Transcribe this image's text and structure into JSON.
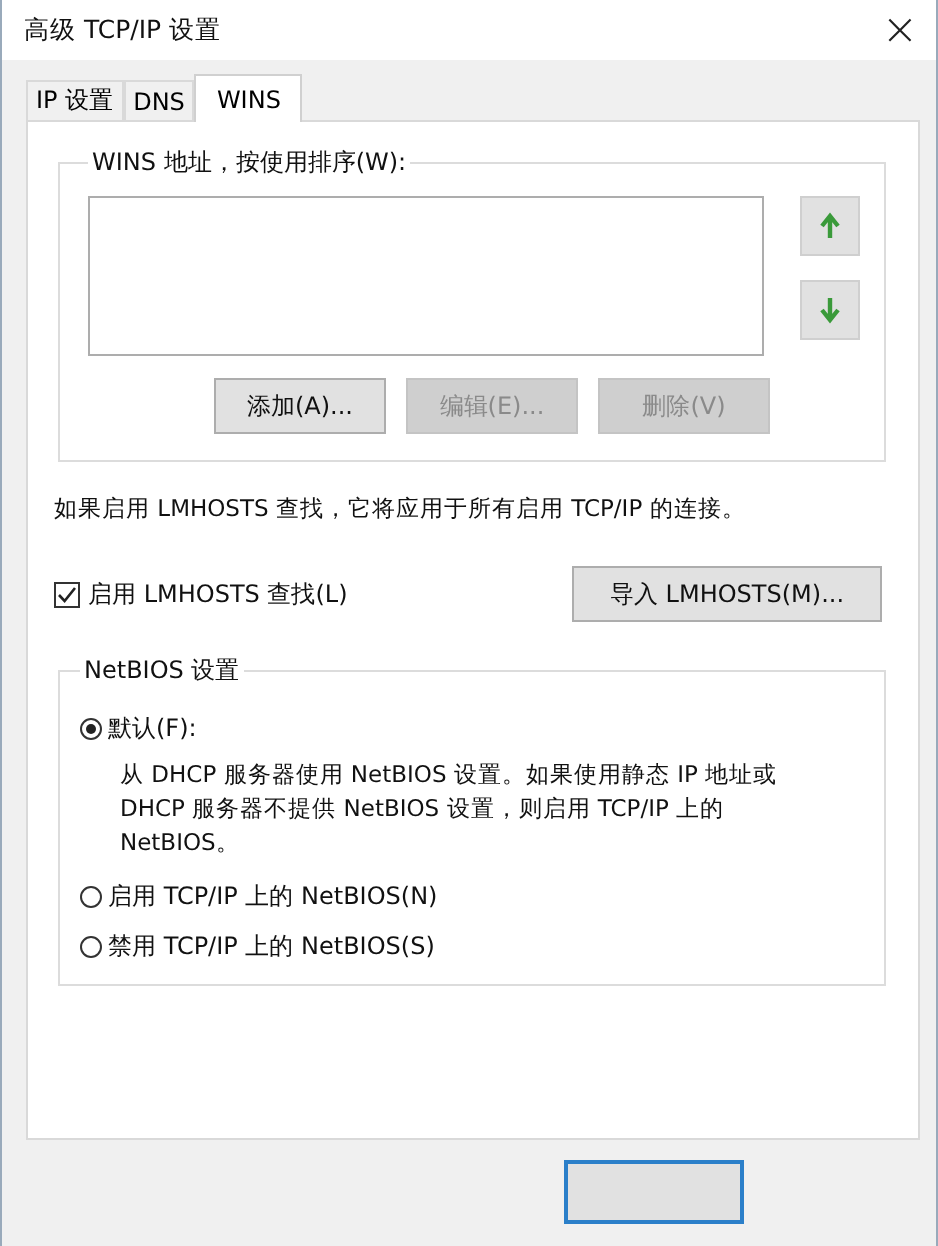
{
  "window": {
    "title": "高级 TCP/IP 设置",
    "close": "×"
  },
  "tabs": [
    {
      "label": "IP 设置",
      "selected": false
    },
    {
      "label": "DNS",
      "selected": false
    },
    {
      "label": "WINS",
      "selected": true
    }
  ],
  "wins_group": {
    "title": "WINS 地址，按使用排序(W):",
    "buttons": [
      {
        "label": "添加(A)...",
        "disabled": false
      },
      {
        "label": "编辑(E)...",
        "disabled": true
      },
      {
        "label": "删除(V)",
        "disabled": true
      }
    ]
  },
  "lmhosts_note": "如果启用 LMHOSTS 查找，它将应用于所有启用 TCP/IP 的连接。",
  "lmhosts_checkbox": {
    "label": "启用 LMHOSTS 查找(L)",
    "checked": true
  },
  "import_button": "导入 LMHOSTS(M)...",
  "netbios_group": {
    "title": "NetBIOS 设置",
    "options": [
      {
        "label": "默认(F):",
        "selected": true,
        "description": "从 DHCP 服务器使用 NetBIOS 设置。如果使用静态 IP 地址或 DHCP 服务器不提供 NetBIOS 设置，则启用 TCP/IP 上的 NetBIOS。"
      },
      {
        "label": "启用 TCP/IP 上的 NetBIOS(N)",
        "selected": false
      },
      {
        "label": "禁用 TCP/IP 上的 NetBIOS(S)",
        "selected": false
      }
    ]
  }
}
